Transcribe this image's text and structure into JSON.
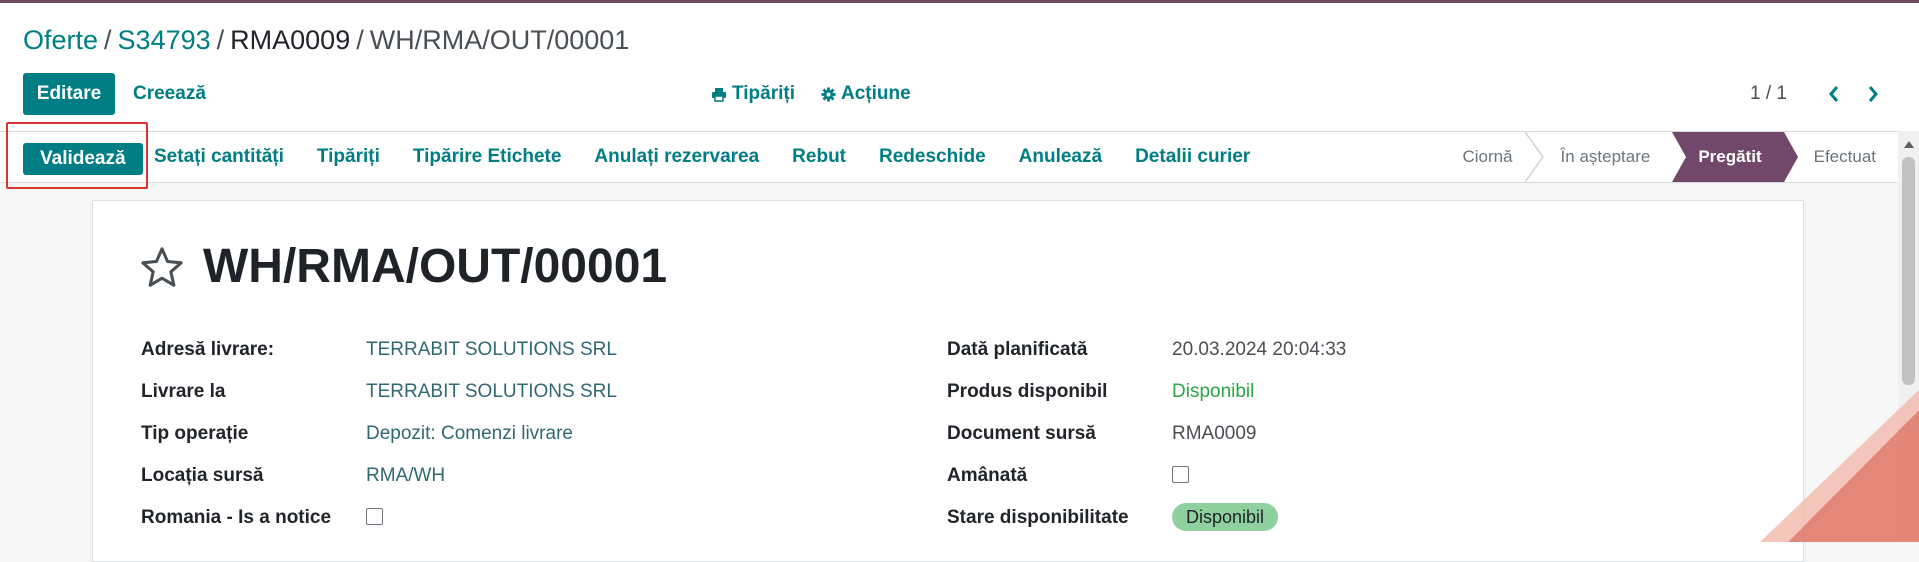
{
  "breadcrumb": {
    "item1": "Oferte",
    "item2": "S34793",
    "item3": "RMA0009",
    "item4": "WH/RMA/OUT/00001",
    "separator": "/"
  },
  "toolbar": {
    "edit_label": "Editare",
    "create_label": "Creează",
    "print_label": "Tipăriți",
    "action_label": "Acțiune"
  },
  "pager": {
    "value": "1 / 1"
  },
  "statusbar": {
    "validate_label": "Validează",
    "actions": [
      "Setați cantități",
      "Tipăriți",
      "Tipărire Etichete",
      "Anulați rezervarea",
      "Rebut",
      "Redeschide",
      "Anulează",
      "Detalii curier"
    ],
    "stages": [
      "Ciornă",
      "În așteptare",
      "Pregătit",
      "Efectuat"
    ],
    "active_stage": "Pregătit",
    "active_color": "#71486a"
  },
  "record": {
    "title": "WH/RMA/OUT/00001",
    "left_fields": [
      {
        "label": "Adresă livrare:",
        "value": "TERRABIT SOLUTIONS SRL"
      },
      {
        "label": "Livrare la",
        "value": "TERRABIT SOLUTIONS SRL"
      },
      {
        "label": "Tip operație",
        "value": "Depozit: Comenzi livrare"
      },
      {
        "label": "Locația sursă",
        "value": "RMA/WH"
      },
      {
        "label": "Romania - Is a notice",
        "value": ""
      }
    ],
    "right_fields": [
      {
        "label": "Dată planificată",
        "value": "20.03.2024 20:04:33"
      },
      {
        "label": "Produs disponibil",
        "value": "Disponibil"
      },
      {
        "label": "Document sursă",
        "value": "RMA0009"
      },
      {
        "label": "Amânată",
        "value": ""
      },
      {
        "label": "Stare disponibilitate",
        "value": "Disponibil"
      }
    ]
  },
  "colors": {
    "primary": "#017e84",
    "highlight": "#d9352f",
    "badge_green": "#8fd19e"
  }
}
